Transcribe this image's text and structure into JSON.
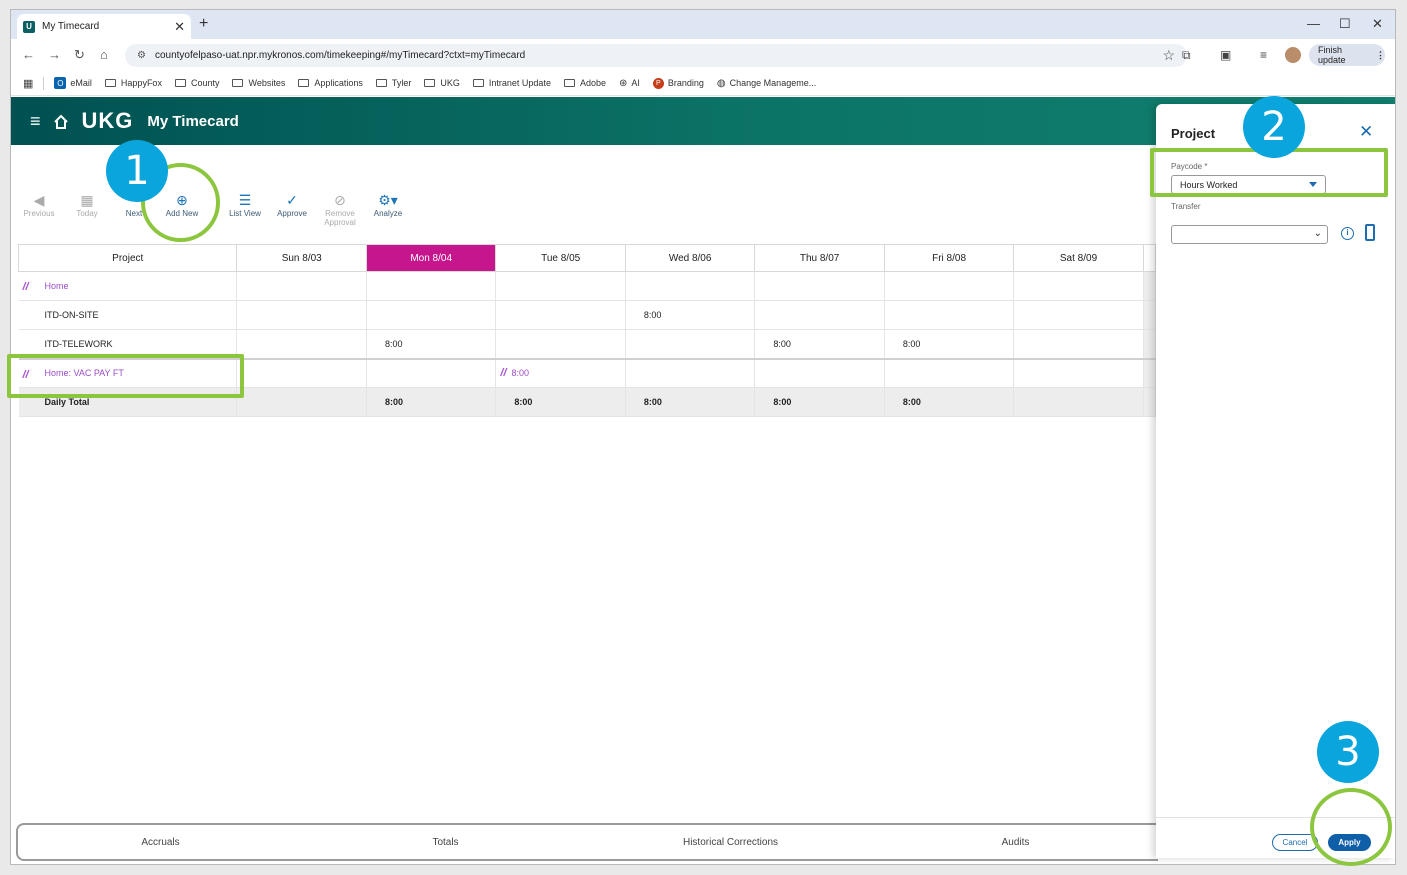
{
  "browser": {
    "tab_title": "My Timecard",
    "tab_close": "✕",
    "new_tab": "+",
    "url": "countyofelpaso-uat.npr.mykronos.com/timekeeping#/myTimecard?ctxt=myTimecard",
    "finish_update": "Finish update",
    "window_controls": {
      "minimize": "—",
      "maximize": "☐",
      "close": "✕"
    },
    "bookmarks": [
      "eMail",
      "HappyFox",
      "County",
      "Websites",
      "Applications",
      "Tyler",
      "UKG",
      "Intranet Update",
      "Adobe",
      "AI",
      "Branding",
      "Change Manageme..."
    ]
  },
  "app": {
    "logo": "UKG",
    "title": "My Timecard"
  },
  "toolbar": {
    "previous": "Previous",
    "today": "Today",
    "next": "Next",
    "add_new": "Add New",
    "list_view": "List View",
    "approve": "Approve",
    "remove_approval_1": "Remove",
    "remove_approval_2": "Approval",
    "analyze": "Analyze"
  },
  "grid": {
    "headers": [
      "Project",
      "Sun 8/03",
      "Mon 8/04",
      "Tue 8/05",
      "Wed 8/06",
      "Thu 8/07",
      "Fri 8/08",
      "Sat 8/09"
    ],
    "rows": [
      {
        "project": "Home",
        "cells": [
          "",
          "",
          "",
          "",
          "",
          "",
          ""
        ]
      },
      {
        "project": "ITD-ON-SITE",
        "cells": [
          "",
          "",
          "",
          "8:00",
          "",
          "",
          ""
        ]
      },
      {
        "project": "ITD-TELEWORK",
        "cells": [
          "",
          "8:00",
          "",
          "",
          "8:00",
          "8:00",
          ""
        ]
      },
      {
        "project": "Home: VAC PAY FT",
        "cells": [
          "",
          "",
          "8:00",
          "",
          "",
          "",
          ""
        ]
      }
    ],
    "total": {
      "label": "Daily Total",
      "cells": [
        "",
        "8:00",
        "8:00",
        "8:00",
        "8:00",
        "8:00",
        ""
      ]
    }
  },
  "bottom_tabs": [
    "Accruals",
    "Totals",
    "Historical Corrections",
    "Audits"
  ],
  "panel": {
    "title": "Project",
    "paycode_label": "Paycode *",
    "paycode_value": "Hours Worked",
    "transfer_label": "Transfer",
    "cancel": "Cancel",
    "apply": "Apply"
  },
  "annotations": {
    "step1": "1",
    "step2": "2",
    "step3": "3"
  },
  "colors": {
    "today": "#c6168d",
    "header": "#005151",
    "accent": "#1d6cb0",
    "highlight": "#8cc63f",
    "badge": "#0aa5dc",
    "transfer_purple": "#9c4cc7"
  }
}
